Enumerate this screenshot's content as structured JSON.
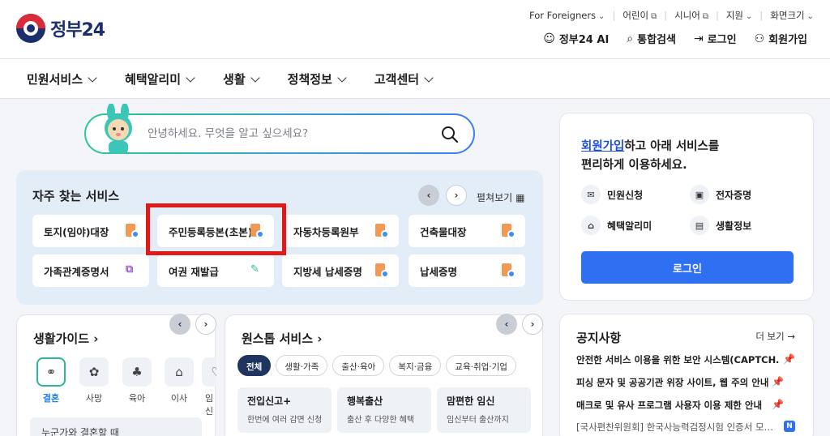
{
  "header": {
    "logo_text": "정부24",
    "utility": [
      {
        "label": "For Foreigners",
        "icon": "chevron-down-icon"
      },
      {
        "label": "어린이",
        "icon": "external-link-icon"
      },
      {
        "label": "시니어",
        "icon": "external-link-icon"
      },
      {
        "label": "지원",
        "icon": "chevron-down-icon"
      },
      {
        "label": "화면크기",
        "icon": "chevron-down-icon"
      }
    ],
    "actions": [
      {
        "label": "정부24 AI",
        "icon": "ai-bot-icon"
      },
      {
        "label": "통합검색",
        "icon": "search-icon"
      },
      {
        "label": "로그인",
        "icon": "login-icon"
      },
      {
        "label": "회원가입",
        "icon": "user-add-icon"
      }
    ]
  },
  "gnb": {
    "items": [
      "민원서비스",
      "혜택알리미",
      "생활",
      "정책정보",
      "고객센터"
    ]
  },
  "search": {
    "placeholder": "안녕하세요. 무엇을 알고 싶으세요?"
  },
  "frequent": {
    "title": "자주 찾는 서비스",
    "view_all": "펼쳐보기",
    "items": [
      "토지(임야)대장",
      "주민등록등본(초본)",
      "자동차등록원부",
      "건축물대장",
      "가족관계증명서",
      "여권 재발급",
      "지방세 납세증명",
      "납세증명"
    ]
  },
  "login_panel": {
    "link": "회원가입",
    "line1_rest": "하고 아래 서비스를",
    "line2": "편리하게 이용하세요.",
    "quick": [
      "민원신청",
      "전자증명",
      "혜택알리미",
      "생활정보"
    ],
    "button": "로그인"
  },
  "guide": {
    "title": "생활가이드",
    "items": [
      "결혼",
      "사망",
      "육아",
      "이사",
      "임신"
    ],
    "bar_text": "누군가와 결혼할 때"
  },
  "onestop": {
    "title": "원스톱 서비스",
    "chips": [
      "전체",
      "생활·가족",
      "출산·육아",
      "복지·금융",
      "교육·취업·기업"
    ],
    "cards": [
      {
        "title": "전입신고+",
        "desc": "한번에 여러 감면 신청"
      },
      {
        "title": "행복출산",
        "desc": "출산 후 다양한 혜택"
      },
      {
        "title": "맘편한 임신",
        "desc": "임신부터 출산까지"
      }
    ]
  },
  "notice": {
    "title": "공지사항",
    "more": "더 보기 →",
    "items": [
      "안전한 서비스 이용을 위한 보안 시스템(CAPTCH…",
      "피싱 문자 및 공공기관 위장 사이트, 웹 주의 안내",
      "매크로 및 유사 프로그램 사용자 이용 제한 안내",
      "[국사편찬위원회] 한국사능력검정시험 인증서 모…"
    ],
    "new_badge": "N"
  }
}
